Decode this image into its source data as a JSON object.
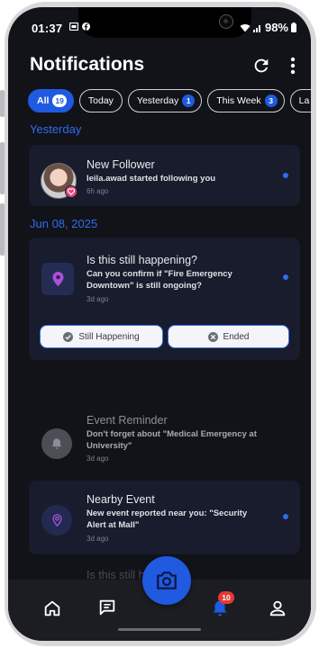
{
  "status_bar": {
    "time": "01:37",
    "battery": "98%",
    "icons": [
      "sim-card-icon",
      "facebook-icon",
      "wifi-icon",
      "signal-icon",
      "battery-icon"
    ]
  },
  "header": {
    "title": "Notifications",
    "icons": [
      "refresh-icon",
      "more-vert-icon"
    ]
  },
  "filters": [
    {
      "label": "All",
      "count": "19",
      "active": true
    },
    {
      "label": "Today",
      "count": null,
      "active": false
    },
    {
      "label": "Yesterday",
      "count": "1",
      "active": false
    },
    {
      "label": "This Week",
      "count": "3",
      "active": false
    },
    {
      "label": "La",
      "count": null,
      "active": false
    }
  ],
  "sections": {
    "yesterday": "Yesterday",
    "jun08": "Jun 08, 2025"
  },
  "notifications": [
    {
      "title": "New Follower",
      "body": "leila.awad started following you",
      "time": "6h ago",
      "unread": true,
      "icon": "heart-icon"
    },
    {
      "title": "Is this still happening?",
      "body": "Can you confirm if \"Fire Emergency Downtown\" is still ongoing?",
      "time": "3d ago",
      "unread": true,
      "icon": "location-pin-icon",
      "actions": [
        {
          "label": "Still Happening",
          "icon": "check-icon"
        },
        {
          "label": "Ended",
          "icon": "close-icon"
        }
      ]
    },
    {
      "title": "Event Reminder",
      "body": "Don't forget about \"Medical Emergency at University\"",
      "time": "3d ago",
      "unread": false,
      "icon": "bell-icon"
    },
    {
      "title": "Nearby Event",
      "body": "New event reported near you: \"Security Alert at Mall\"",
      "time": "3d ago",
      "unread": true,
      "icon": "location-pin-icon"
    },
    {
      "title": "Is this still h",
      "body": "",
      "time": "",
      "unread": false,
      "icon": "location-pin-icon"
    }
  ],
  "bottom_nav": {
    "items": [
      "home-icon",
      "chat-icon",
      "camera-icon",
      "bell-icon",
      "profile-icon"
    ],
    "notification_count": "10"
  },
  "colors": {
    "background": "#121318",
    "card": "#181c2c",
    "accent": "#1f5ae0",
    "section_label": "#2f6cf0",
    "badge_red": "#e53935"
  }
}
